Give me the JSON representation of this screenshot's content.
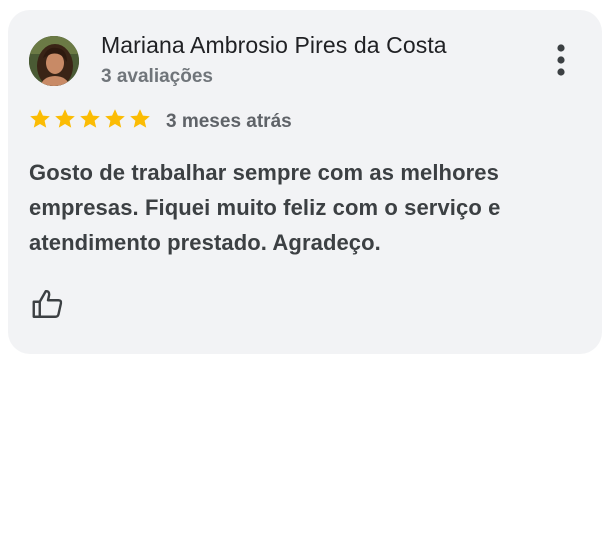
{
  "review": {
    "author_name": "Mariana Ambrosio Pires da Costa",
    "review_count": "3 avaliações",
    "rating": 5,
    "rating_max": 5,
    "time_ago": "3 meses atrás",
    "text": "Gosto de trabalhar sempre com as melhores empresas. Fiquei muito feliz com o serviço e atendimento prestado. Agradeço.",
    "avatar_icon": "user-photo",
    "more_icon": "vertical-dots-icon",
    "like_icon": "thumbs-up-icon"
  },
  "colors": {
    "card_background": "#f2f3f5",
    "star": "#fbbc04",
    "name": "#202124",
    "secondary_text": "#70757a",
    "body_text": "#3c4043"
  }
}
